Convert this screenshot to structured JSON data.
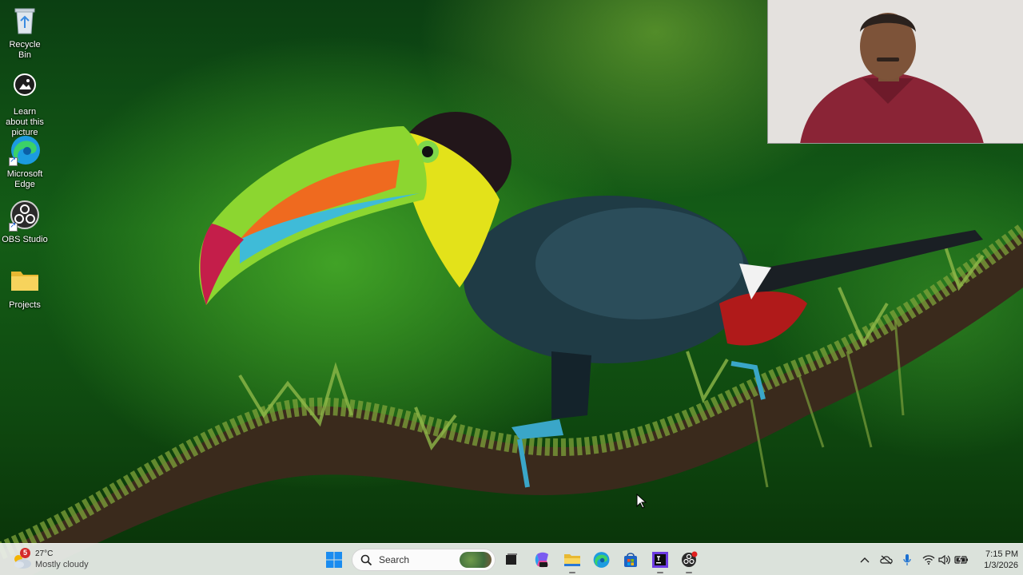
{
  "desktop": {
    "icons": [
      {
        "label": "Recycle Bin",
        "icon": "recycle-bin-icon"
      },
      {
        "label": "Learn about this picture",
        "icon": "learn-about-picture-icon"
      },
      {
        "label": "Microsoft Edge",
        "icon": "edge-icon"
      },
      {
        "label": "OBS Studio",
        "icon": "obs-icon"
      },
      {
        "label": "Projects",
        "icon": "folder-icon"
      }
    ]
  },
  "taskbar": {
    "weather": {
      "badge": "5",
      "temperature": "27°C",
      "condition": "Mostly cloudy"
    },
    "search": {
      "placeholder": "Search"
    },
    "apps": [
      "start-icon",
      "task-view-icon",
      "copilot-icon",
      "file-explorer-icon",
      "edge-icon",
      "microsoft-store-icon",
      "jetbrains-icon",
      "obs-icon"
    ],
    "tray": [
      "chevron-up-icon",
      "onedrive-icon",
      "microphone-icon",
      "wifi-icon",
      "volume-icon",
      "battery-icon"
    ],
    "clock": {
      "time": "7:15 PM",
      "date": "1/3/2026"
    }
  },
  "colors": {
    "taskbar_bg": "#ecf0ec",
    "accent": "#0078d4"
  }
}
